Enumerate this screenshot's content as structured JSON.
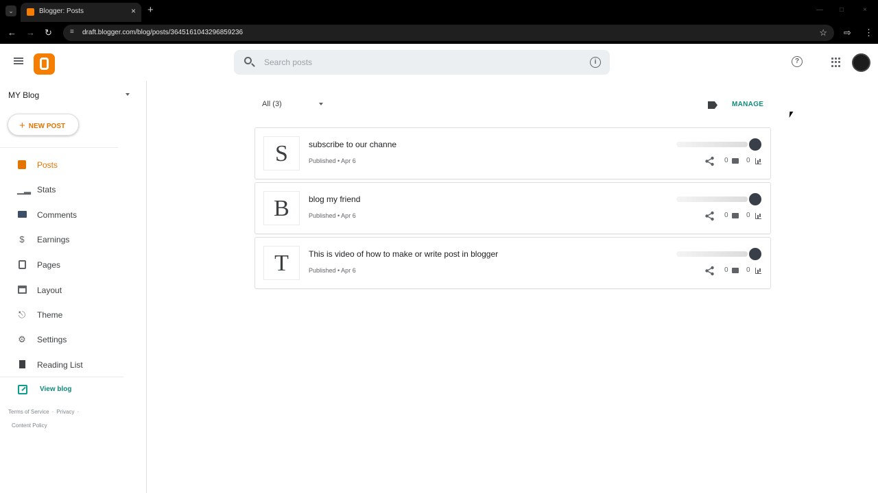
{
  "browser": {
    "tab_title": "Blogger: Posts",
    "url": "draft.blogger.com/blog/posts/3645161043296859236"
  },
  "header": {
    "search_placeholder": "Search posts"
  },
  "sidebar": {
    "blog_name": "MY Blog",
    "new_post_label": "NEW POST",
    "items": [
      {
        "label": "Posts",
        "icon": "posts-icon",
        "active": true
      },
      {
        "label": "Stats",
        "icon": "stats-icon",
        "active": false
      },
      {
        "label": "Comments",
        "icon": "comments-icon",
        "active": false
      },
      {
        "label": "Earnings",
        "icon": "earnings-icon",
        "active": false
      },
      {
        "label": "Pages",
        "icon": "pages-icon",
        "active": false
      },
      {
        "label": "Layout",
        "icon": "layout-icon",
        "active": false
      },
      {
        "label": "Theme",
        "icon": "theme-icon",
        "active": false
      },
      {
        "label": "Settings",
        "icon": "settings-icon",
        "active": false
      },
      {
        "label": "Reading List",
        "icon": "reading-list-icon",
        "active": false
      }
    ],
    "view_blog_label": "View blog",
    "footer": {
      "terms": "Terms of Service",
      "privacy": "Privacy",
      "content_policy": "Content Policy"
    }
  },
  "main": {
    "filter_label": "All (3)",
    "manage_label": "MANAGE",
    "posts": [
      {
        "initial": "S",
        "title": "subscribe to our channe",
        "status": "Published • Apr 6",
        "comments": "0",
        "views": "0"
      },
      {
        "initial": "B",
        "title": "blog my friend",
        "status": "Published • Apr 6",
        "comments": "0",
        "views": "0"
      },
      {
        "initial": "T",
        "title": "This is video of how to make or write post in blogger",
        "status": "Published • Apr 6",
        "comments": "0",
        "views": "0"
      }
    ]
  },
  "colors": {
    "brand": "#f57d00",
    "active_nav": "#e37400",
    "link_teal": "#0f8a7a"
  }
}
